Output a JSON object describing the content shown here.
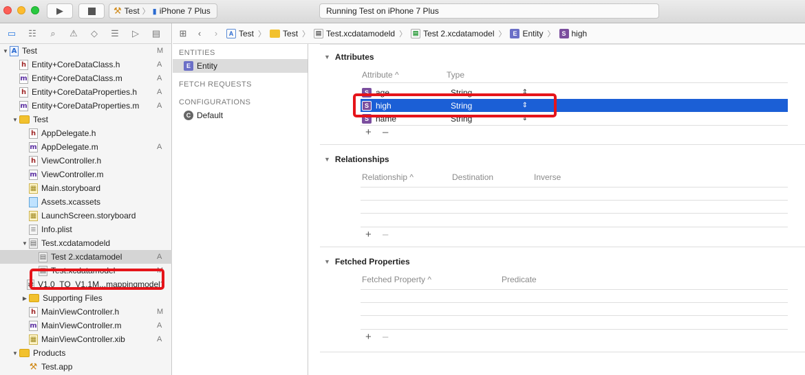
{
  "toolbar": {
    "scheme": "Test",
    "device": "iPhone 7 Plus",
    "activity": "Running Test on iPhone 7 Plus"
  },
  "navigator": {
    "items": [
      {
        "label": "Test",
        "status": "M",
        "icon": "project-icon",
        "indent": 0,
        "disclosure": "open"
      },
      {
        "label": "Entity+CoreDataClass.h",
        "status": "A",
        "icon": "h-file-icon",
        "indent": 1
      },
      {
        "label": "Entity+CoreDataClass.m",
        "status": "A",
        "icon": "m-file-icon",
        "indent": 1
      },
      {
        "label": "Entity+CoreDataProperties.h",
        "status": "A",
        "icon": "h-file-icon",
        "indent": 1
      },
      {
        "label": "Entity+CoreDataProperties.m",
        "status": "A",
        "icon": "m-file-icon",
        "indent": 1
      },
      {
        "label": "Test",
        "status": "",
        "icon": "folder-icon",
        "indent": 1,
        "disclosure": "open"
      },
      {
        "label": "AppDelegate.h",
        "status": "",
        "icon": "h-file-icon",
        "indent": 2
      },
      {
        "label": "AppDelegate.m",
        "status": "A",
        "icon": "m-file-icon",
        "indent": 2
      },
      {
        "label": "ViewController.h",
        "status": "",
        "icon": "h-file-icon",
        "indent": 2
      },
      {
        "label": "ViewController.m",
        "status": "",
        "icon": "m-file-icon",
        "indent": 2
      },
      {
        "label": "Main.storyboard",
        "status": "",
        "icon": "storyboard-icon",
        "indent": 2
      },
      {
        "label": "Assets.xcassets",
        "status": "",
        "icon": "assets-icon",
        "indent": 2
      },
      {
        "label": "LaunchScreen.storyboard",
        "status": "",
        "icon": "storyboard-icon",
        "indent": 2
      },
      {
        "label": "Info.plist",
        "status": "",
        "icon": "plist-icon",
        "indent": 2
      },
      {
        "label": "Test.xcdatamodeld",
        "status": "",
        "icon": "datamodel-icon",
        "indent": 2,
        "disclosure": "open"
      },
      {
        "label": "Test 2.xcdatamodel",
        "status": "A",
        "icon": "datamodel-icon",
        "indent": 3,
        "selected": true
      },
      {
        "label": "Test.xcdatamodel",
        "status": "M",
        "icon": "datamodel-icon",
        "indent": 3
      },
      {
        "label": "V1.0_TO_V1.1M...mappingmodel",
        "status": "?",
        "icon": "mapping-icon",
        "indent": 2
      },
      {
        "label": "Supporting Files",
        "status": "",
        "icon": "folder-icon",
        "indent": 2,
        "disclosure": "closed"
      },
      {
        "label": "MainViewController.h",
        "status": "M",
        "icon": "h-file-icon",
        "indent": 2
      },
      {
        "label": "MainViewController.m",
        "status": "A",
        "icon": "m-file-icon",
        "indent": 2
      },
      {
        "label": "MainViewController.xib",
        "status": "A",
        "icon": "xib-icon",
        "indent": 2
      },
      {
        "label": "Products",
        "status": "",
        "icon": "folder-icon",
        "indent": 1,
        "disclosure": "open"
      },
      {
        "label": "Test.app",
        "status": "",
        "icon": "app-icon",
        "indent": 2
      }
    ]
  },
  "jumpbar": {
    "crumbs": [
      "Test",
      "Test",
      "Test.xcdatamodeld",
      "Test 2.xcdatamodel",
      "Entity",
      "high"
    ]
  },
  "entities_pane": {
    "entities_heading": "ENTITIES",
    "entity": "Entity",
    "fetch_heading": "FETCH REQUESTS",
    "config_heading": "CONFIGURATIONS",
    "config": "Default"
  },
  "attributes": {
    "title": "Attributes",
    "col_attr": "Attribute",
    "col_type": "Type",
    "rows": [
      {
        "name": "age",
        "type": "String"
      },
      {
        "name": "high",
        "type": "String"
      },
      {
        "name": "name",
        "type": "String"
      }
    ]
  },
  "relationships": {
    "title": "Relationships",
    "col_rel": "Relationship",
    "col_dest": "Destination",
    "col_inv": "Inverse"
  },
  "fetched": {
    "title": "Fetched Properties",
    "col_prop": "Fetched Property",
    "col_pred": "Predicate"
  },
  "icons": {
    "add": "+",
    "remove": "–",
    "sort_asc": "^"
  },
  "colors": {
    "selection": "#1b5fd6",
    "highlight_box": "#e5141a"
  }
}
